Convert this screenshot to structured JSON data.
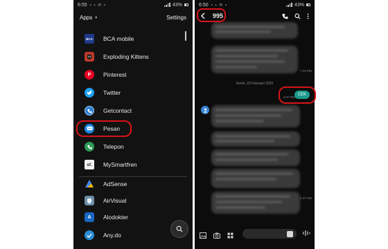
{
  "left_phone": {
    "status": {
      "time": "6:55",
      "battery": "43%"
    },
    "header": {
      "title": "Apps",
      "caret": "▾",
      "settings": "Settings"
    },
    "apps": [
      {
        "id": "bca",
        "label": "BCA mobile",
        "icon_text": "BCA",
        "icon": "bca-mobile-icon"
      },
      {
        "id": "ek",
        "label": "Exploding Kittens",
        "icon_text": "",
        "icon": "exploding-kittens-icon"
      },
      {
        "id": "pin",
        "label": "Pinterest",
        "icon_text": "P",
        "icon": "pinterest-icon"
      },
      {
        "id": "tw",
        "label": "Twitter",
        "icon_text": "",
        "icon": "twitter-icon"
      },
      {
        "id": "gc",
        "label": "Getcontact",
        "icon_text": "",
        "icon": "getcontact-icon"
      },
      {
        "id": "pesan",
        "label": "Pesan",
        "icon_text": "",
        "icon": "messages-icon"
      },
      {
        "id": "tel",
        "label": "Telepon",
        "icon_text": "",
        "icon": "phone-icon"
      },
      {
        "id": "msf",
        "label": "MySmartfren",
        "icon_text": "sf.",
        "icon": "mysmartfren-icon"
      },
      {
        "id": "ads",
        "label": "AdSense",
        "icon_text": "",
        "icon": "adsense-icon"
      },
      {
        "id": "av",
        "label": "AirVisual",
        "icon_text": "",
        "icon": "airvisual-icon"
      },
      {
        "id": "alo",
        "label": "Alodokter",
        "icon_text": "A",
        "icon": "alodokter-icon"
      },
      {
        "id": "any",
        "label": "Any.do",
        "icon_text": "",
        "icon": "anydo-icon"
      }
    ],
    "highlighted_app": "Pesan"
  },
  "right_phone": {
    "status": {
      "time": "6:50",
      "battery": "43%"
    },
    "conversation": {
      "title": "995"
    },
    "messages": {
      "time_1": "7:13 PM",
      "date_separator": "Senin, 03 Februari 2020",
      "sent_text": "CEK",
      "sent_time": "2:47 PM",
      "time_2": "2:47 PM"
    }
  },
  "colors": {
    "highlight": "#d7141a",
    "sent_bubble": "#1a9a8c",
    "background": "#121212"
  }
}
